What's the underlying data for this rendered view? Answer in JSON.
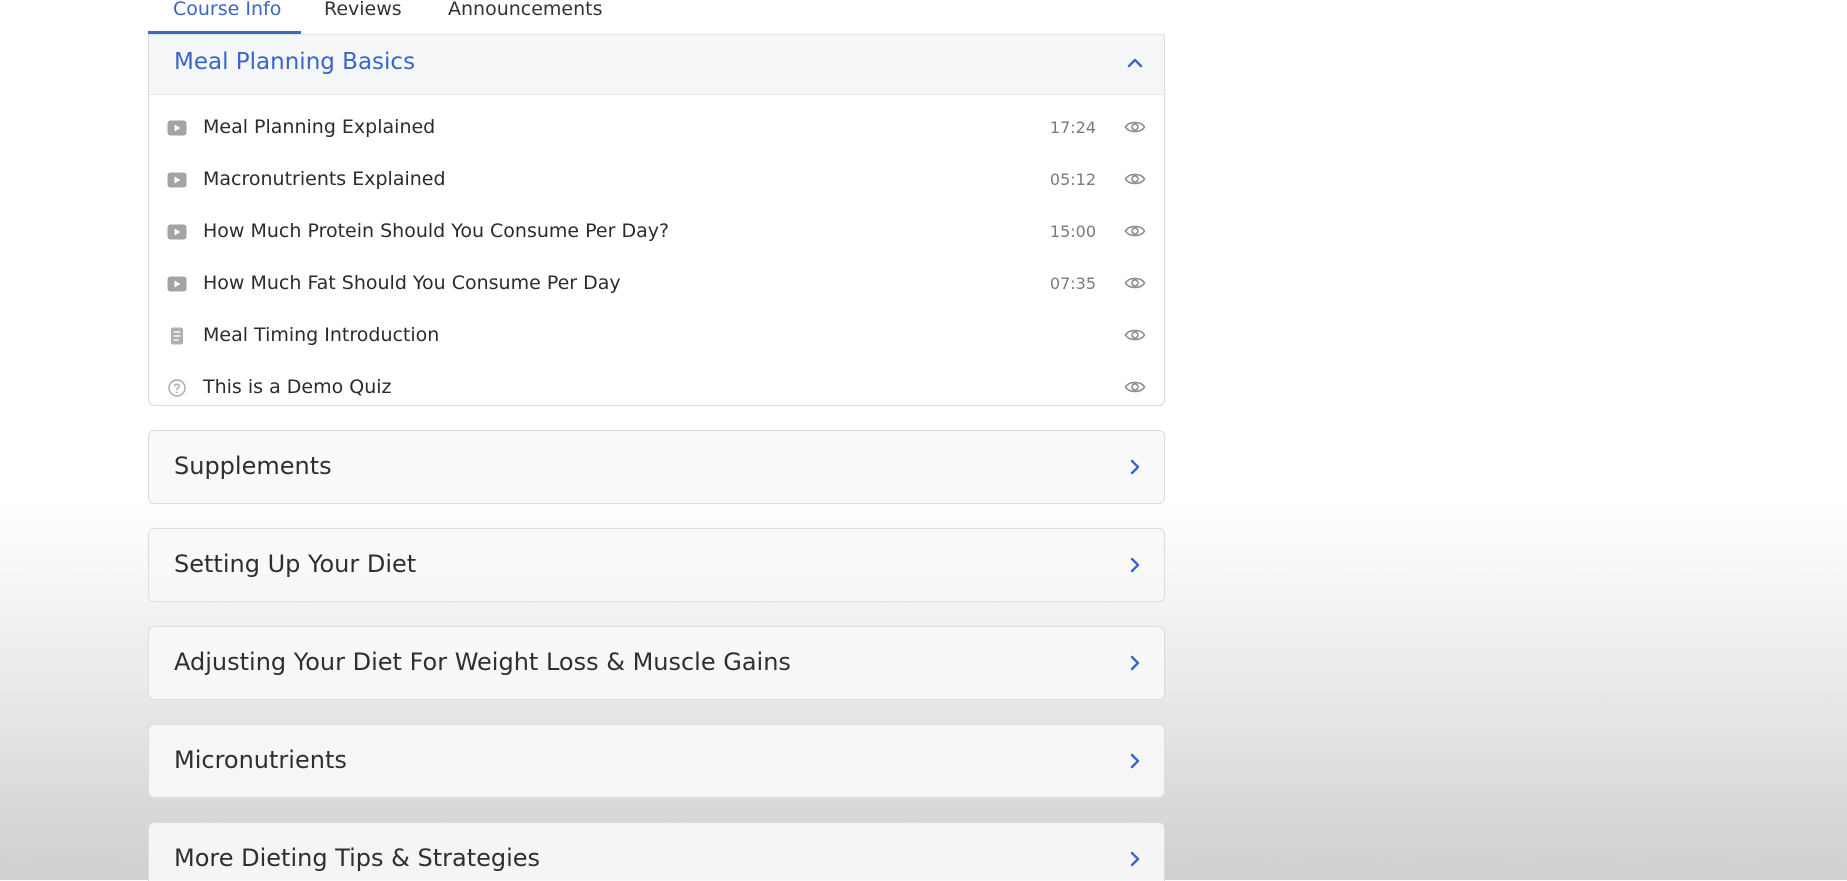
{
  "tabs": [
    {
      "label": "Course Info",
      "active": true
    },
    {
      "label": "Reviews"
    },
    {
      "label": "Announcements"
    }
  ],
  "open_section": {
    "title": "Meal Planning Basics",
    "lessons": [
      {
        "type": "video",
        "title": "Meal Planning Explained",
        "duration": "17:24"
      },
      {
        "type": "video",
        "title": "Macronutrients Explained",
        "duration": "05:12"
      },
      {
        "type": "video",
        "title": "How Much Protein Should You Consume Per Day?",
        "duration": "15:00"
      },
      {
        "type": "video",
        "title": "How Much Fat Should You Consume Per Day",
        "duration": "07:35"
      },
      {
        "type": "document",
        "title": "Meal Timing Introduction",
        "duration": ""
      },
      {
        "type": "quiz",
        "title": "This is a Demo Quiz",
        "duration": ""
      }
    ]
  },
  "sections": [
    {
      "title": "Supplements"
    },
    {
      "title": "Setting Up Your Diet"
    },
    {
      "title": "Adjusting Your Diet For Weight Loss & Muscle Gains"
    },
    {
      "title": "Micronutrients"
    },
    {
      "title": "More Dieting Tips & Strategies"
    }
  ],
  "colors": {
    "accent": "#3a66c6",
    "icon_gray": "#9a9a9a",
    "text": "#2b2b2b"
  }
}
